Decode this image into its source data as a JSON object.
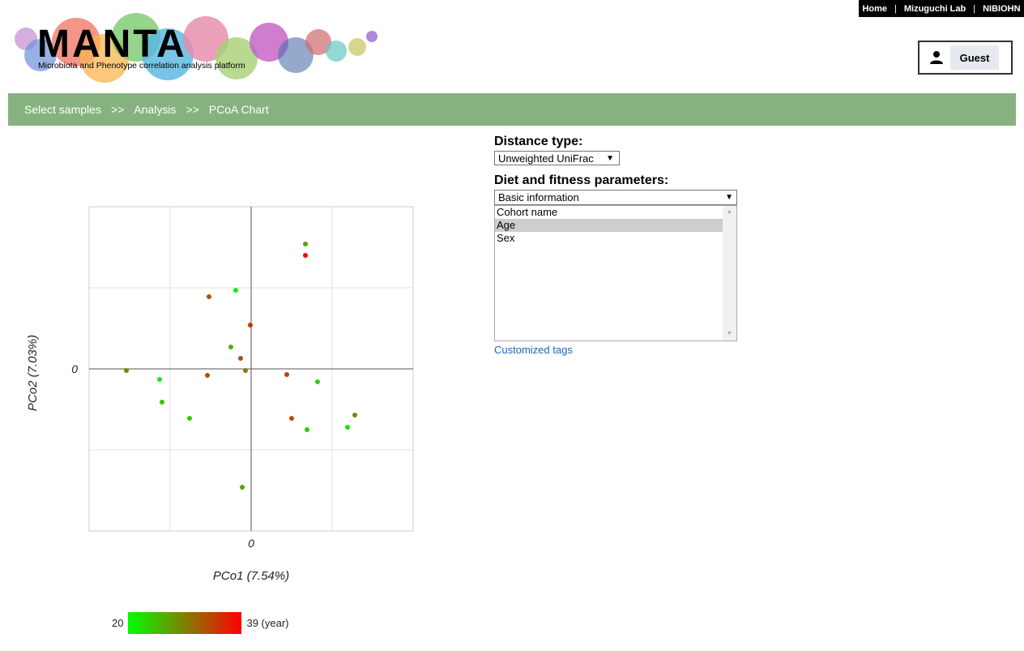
{
  "top_links": [
    "Home",
    "Mizuguchi Lab",
    "NIBIOHN"
  ],
  "logo": {
    "title": "MANTA",
    "subtitle": "Microbiota and Phenotype correlation analysis platform"
  },
  "user": {
    "label": "Guest",
    "icon": "user-icon"
  },
  "breadcrumb": [
    "Select samples",
    "Analysis",
    "PCoA Chart"
  ],
  "breadcrumb_separator": ">>",
  "distance": {
    "label": "Distance type:",
    "value": "Unweighted UniFrac"
  },
  "params": {
    "label": "Diet and fitness parameters:",
    "value": "Basic information",
    "options": [
      "Cohort name",
      "Age",
      "Sex"
    ],
    "selected": "Age"
  },
  "custom_tags": "Customized tags",
  "legend": {
    "min": "20",
    "max": "39 (year)",
    "colors": [
      "#00ff00",
      "#808000",
      "#ff0000"
    ]
  },
  "chart_data": {
    "type": "scatter",
    "xlabel": "PCo1 (7.54%)",
    "ylabel": "PCo2 (7.03%)",
    "x_tick_labels": [
      "0"
    ],
    "y_tick_labels": [
      "0"
    ],
    "xlim": [
      -2,
      2
    ],
    "ylim": [
      -2,
      2
    ],
    "grid": true,
    "color_scale": {
      "min": 20,
      "max": 39,
      "unit": "year"
    },
    "points": [
      {
        "x": 0.67,
        "y": 1.54,
        "age": 27
      },
      {
        "x": 0.67,
        "y": 1.4,
        "age": 39
      },
      {
        "x": -0.19,
        "y": 0.97,
        "age": 21
      },
      {
        "x": -0.52,
        "y": 0.89,
        "age": 33
      },
      {
        "x": -0.01,
        "y": 0.54,
        "age": 35
      },
      {
        "x": -0.25,
        "y": 0.27,
        "age": 26
      },
      {
        "x": -0.13,
        "y": 0.13,
        "age": 33
      },
      {
        "x": -1.54,
        "y": -0.02,
        "age": 29
      },
      {
        "x": -0.07,
        "y": -0.02,
        "age": 30
      },
      {
        "x": -0.54,
        "y": -0.08,
        "age": 33
      },
      {
        "x": 0.44,
        "y": -0.07,
        "age": 34
      },
      {
        "x": -1.13,
        "y": -0.13,
        "age": 21
      },
      {
        "x": 0.82,
        "y": -0.16,
        "age": 24
      },
      {
        "x": -1.1,
        "y": -0.41,
        "age": 25
      },
      {
        "x": 1.28,
        "y": -0.57,
        "age": 29
      },
      {
        "x": -0.76,
        "y": -0.61,
        "age": 24
      },
      {
        "x": 0.5,
        "y": -0.61,
        "age": 33
      },
      {
        "x": 0.69,
        "y": -0.75,
        "age": 24
      },
      {
        "x": 1.19,
        "y": -0.72,
        "age": 22
      },
      {
        "x": -0.11,
        "y": -1.46,
        "age": 27
      }
    ]
  }
}
